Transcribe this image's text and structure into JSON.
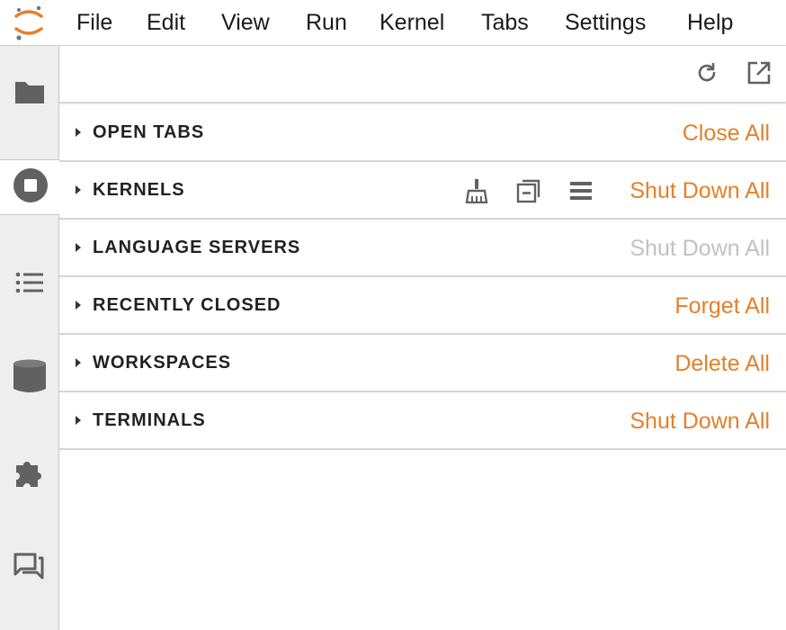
{
  "menubar": {
    "items": [
      "File",
      "Edit",
      "View",
      "Run",
      "Kernel",
      "Tabs",
      "Settings",
      "Help"
    ]
  },
  "activity_bar": {
    "icons": [
      "folder-icon",
      "running-stop-icon",
      "list-icon",
      "database-icon",
      "extension-puzzle-icon",
      "chat-icon"
    ],
    "active": "running-stop-icon"
  },
  "toolbar": {
    "icons": [
      "refresh-icon",
      "open-external-icon"
    ]
  },
  "sections": [
    {
      "title": "OPEN TABS",
      "action": "Close All",
      "enabled": true
    },
    {
      "title": "KERNELS",
      "action": "Shut Down All",
      "enabled": true,
      "icons": [
        "clear-broom-icon",
        "collapse-icon",
        "list-view-icon"
      ]
    },
    {
      "title": "LANGUAGE SERVERS",
      "action": "Shut Down All",
      "enabled": false
    },
    {
      "title": "RECENTLY CLOSED",
      "action": "Forget All",
      "enabled": true
    },
    {
      "title": "WORKSPACES",
      "action": "Delete All",
      "enabled": true
    },
    {
      "title": "TERMINALS",
      "action": "Shut Down All",
      "enabled": true
    }
  ],
  "colors": {
    "accent": "#e57f2a",
    "disabled": "#c2c2c2",
    "icon": "#616161"
  }
}
